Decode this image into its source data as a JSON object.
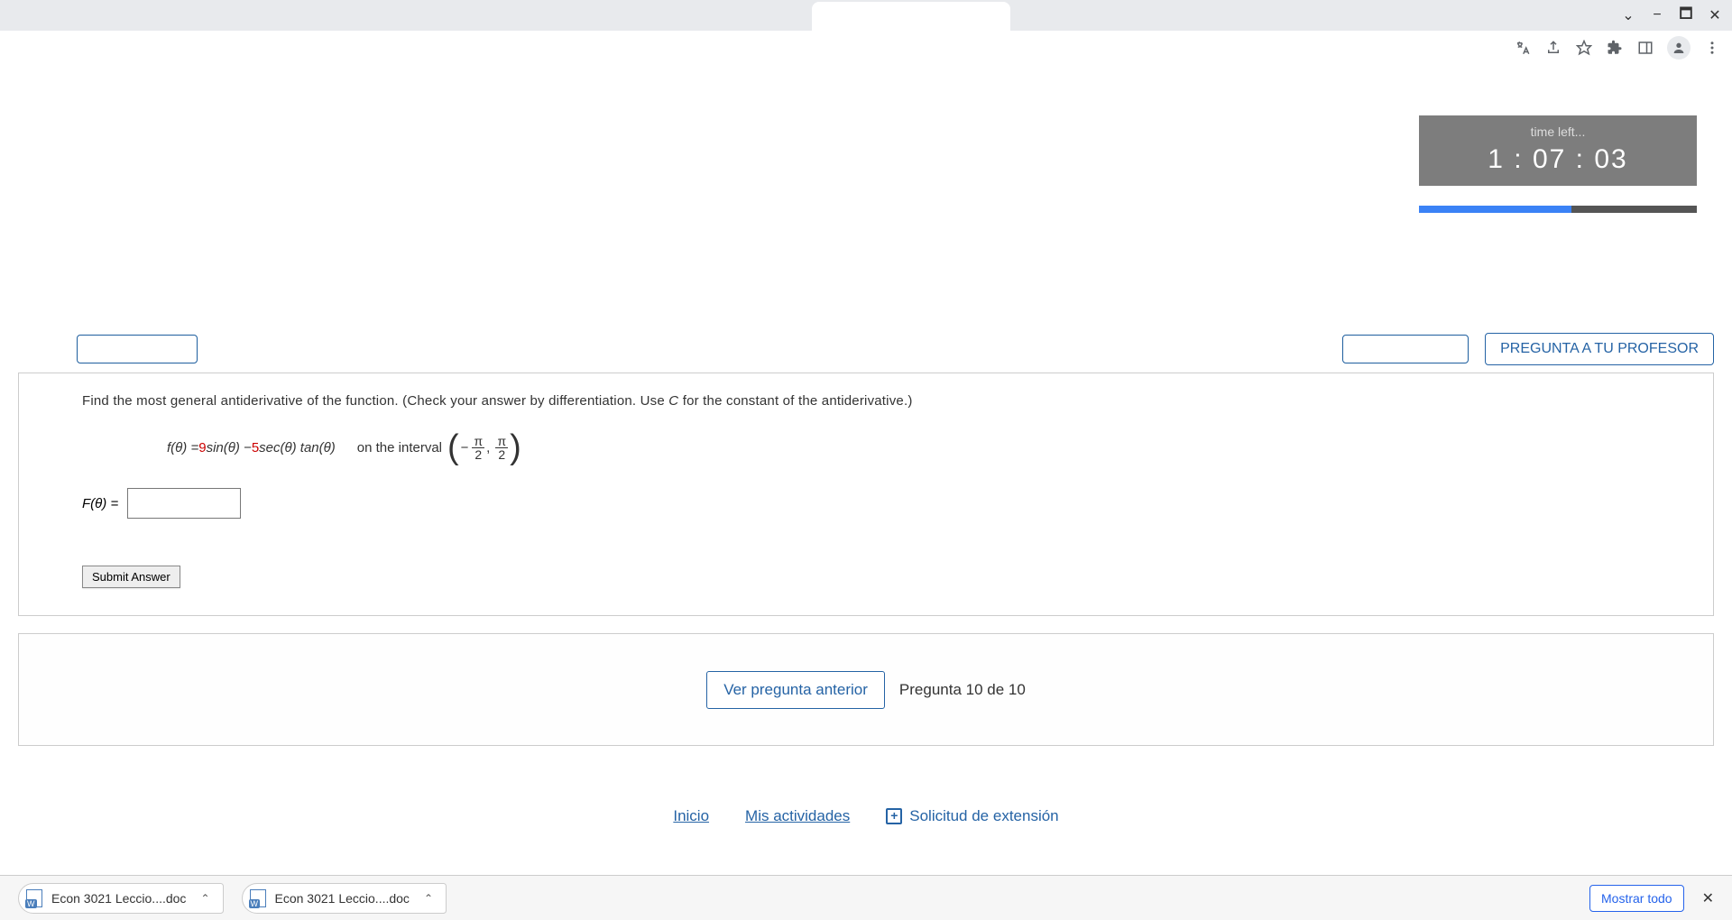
{
  "browser": {
    "win_controls": {
      "min": "−",
      "max": "🗖",
      "close": "✕",
      "down": "⌄"
    }
  },
  "timer": {
    "label": "time left...",
    "value": "1 : 07 : 03",
    "progress_pct": 55
  },
  "action_bar": {
    "ask_prof": "PREGUNTA A TU PROFESOR"
  },
  "question": {
    "instructions_pre": "Find the most general antiderivative of the function. (Check your answer by differentiation. Use ",
    "instructions_var": "C",
    "instructions_post": " for the constant of the antiderivative.)",
    "func_lhs": "f(θ) = ",
    "coef1": "9",
    "trig1": " sin(θ) − ",
    "coef2": "5",
    "trig2": " sec(θ) tan(θ)",
    "interval_label": "on the interval",
    "frac_top": "π",
    "frac_bot": "2",
    "answer_lhs": "F(θ) = ",
    "submit": "Submit Answer"
  },
  "nav": {
    "prev": "Ver pregunta anterior",
    "position": "Pregunta 10 de 10"
  },
  "footer_links": {
    "home": "Inicio",
    "activities": "Mis actividades",
    "extension": "Solicitud de extensión"
  },
  "downloads": {
    "file1": "Econ 3021 Leccio....doc",
    "file2": "Econ 3021 Leccio....doc",
    "show_all": "Mostrar todo",
    "close": "✕"
  }
}
